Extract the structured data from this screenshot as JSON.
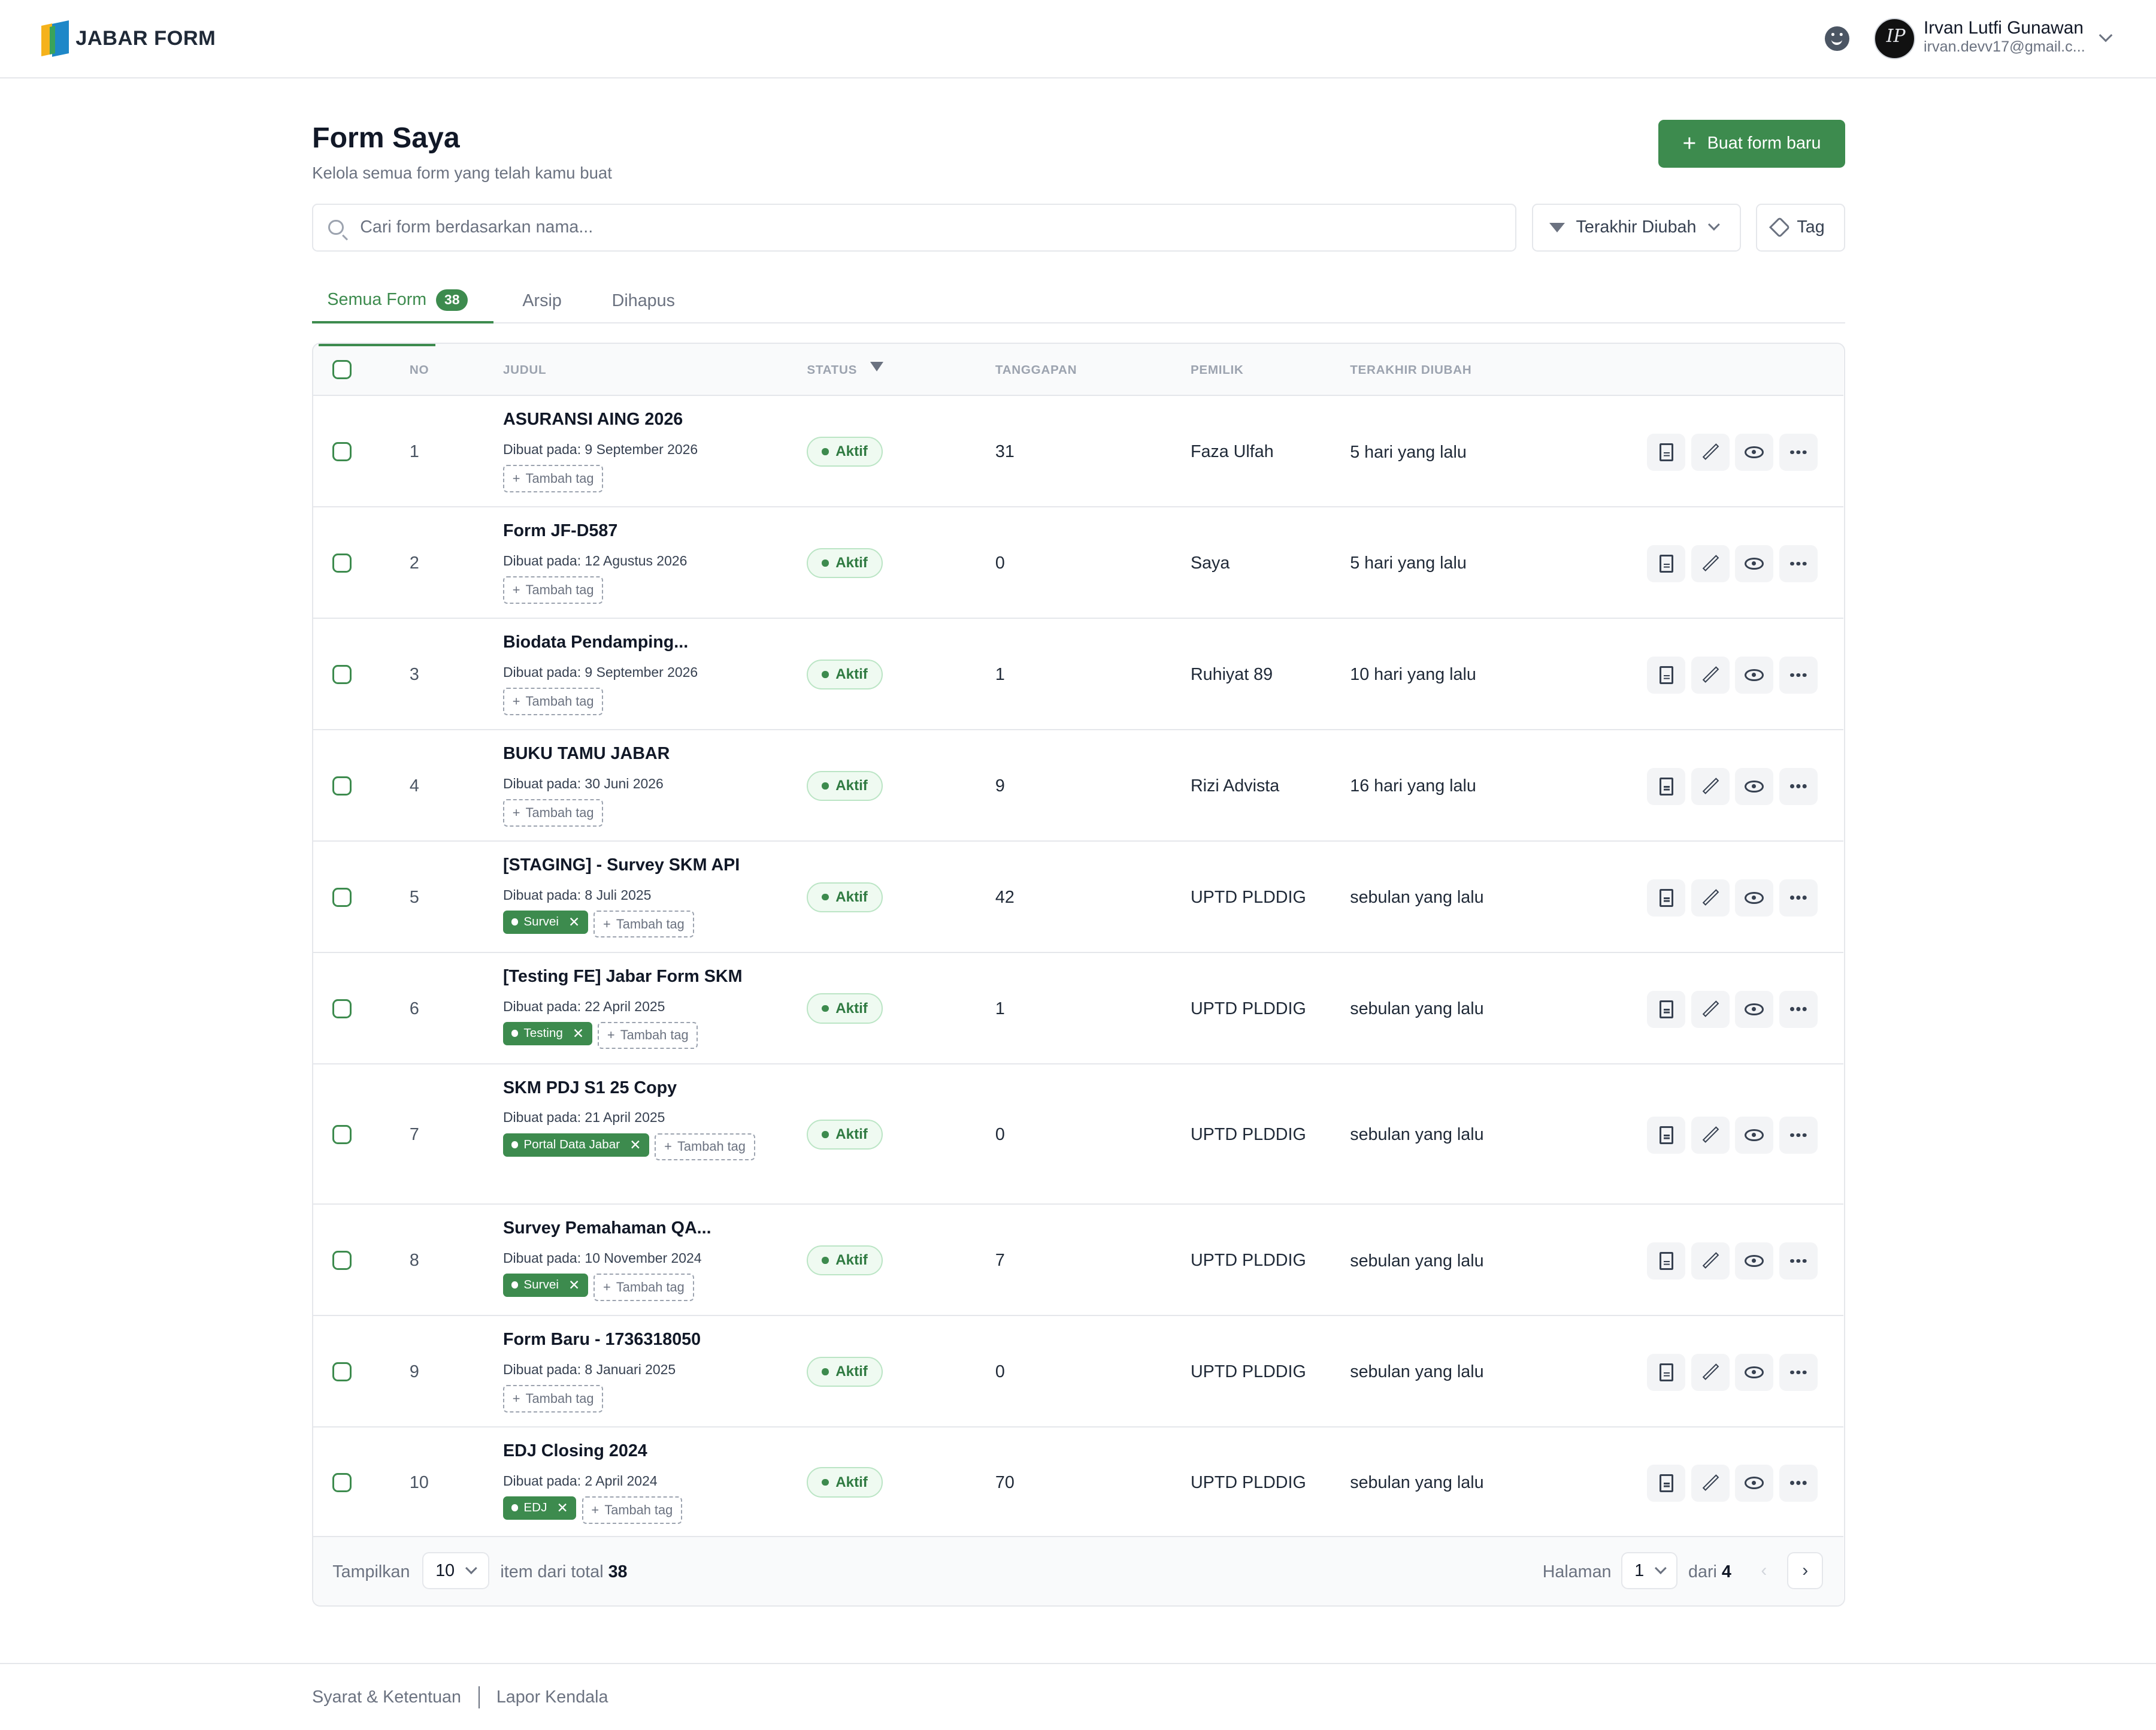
{
  "app": {
    "logo_text": "JABAR FORM"
  },
  "user": {
    "name": "Irvan Lutfi Gunawan",
    "email": "irvan.devv17@gmail.c...",
    "avatar_initials": "IP"
  },
  "page": {
    "title": "Form Saya",
    "subtitle": "Kelola semua form yang telah kamu buat",
    "new_button": "Buat form baru"
  },
  "search": {
    "placeholder": "Cari form berdasarkan nama...",
    "value": ""
  },
  "sort": {
    "label": "Terakhir Diubah"
  },
  "tag_filter": {
    "label": "Tag"
  },
  "tabs": [
    {
      "label": "Semua Form",
      "count": "38",
      "active": true
    },
    {
      "label": "Arsip"
    },
    {
      "label": "Dihapus"
    }
  ],
  "table": {
    "headers": {
      "no": "NO",
      "judul": "JUDUL",
      "status": "STATUS",
      "tanggapan": "TANGGAPAN",
      "pemilik": "PEMILIK",
      "terakhir": "TERAKHIR DIUBAH"
    },
    "add_tag_label": "Tambah tag",
    "rows": [
      {
        "no": "1",
        "title": "ASURANSI AING 2026",
        "created": "Dibuat pada: 9 September 2026",
        "tags": [],
        "status": "Aktif",
        "responses": "31",
        "owner": "Faza Ulfah",
        "updated": "5 hari yang lalu"
      },
      {
        "no": "2",
        "title": "Form JF-D587",
        "created": "Dibuat pada: 12 Agustus 2026",
        "tags": [],
        "status": "Aktif",
        "responses": "0",
        "owner": "Saya",
        "updated": "5 hari yang lalu"
      },
      {
        "no": "3",
        "title": "Biodata Pendamping...",
        "created": "Dibuat pada: 9 September 2026",
        "tags": [],
        "status": "Aktif",
        "responses": "1",
        "owner": "Ruhiyat 89",
        "updated": "10 hari yang lalu"
      },
      {
        "no": "4",
        "title": "BUKU TAMU JABAR",
        "created": "Dibuat pada: 30 Juni 2026",
        "tags": [],
        "status": "Aktif",
        "responses": "9",
        "owner": "Rizi Advista",
        "updated": "16 hari yang lalu"
      },
      {
        "no": "5",
        "title": "[STAGING] - Survey SKM API",
        "created": "Dibuat pada: 8 Juli 2025",
        "tags": [
          "Survei"
        ],
        "status": "Aktif",
        "responses": "42",
        "owner": "UPTD PLDDIG",
        "updated": "sebulan yang lalu"
      },
      {
        "no": "6",
        "title": "[Testing FE] Jabar Form SKM",
        "created": "Dibuat pada: 22 April 2025",
        "tags": [
          "Testing"
        ],
        "status": "Aktif",
        "responses": "1",
        "owner": "UPTD PLDDIG",
        "updated": "sebulan yang lalu"
      },
      {
        "no": "7",
        "title": "SKM PDJ S1 25 Copy",
        "created": "Dibuat pada: 21 April 2025",
        "tags": [
          "Portal Data Jabar"
        ],
        "status": "Aktif",
        "responses": "0",
        "owner": "UPTD PLDDIG",
        "updated": "sebulan yang lalu"
      },
      {
        "no": "8",
        "title": "Survey Pemahaman QA...",
        "created": "Dibuat pada: 10 November 2024",
        "tags": [
          "Survei"
        ],
        "status": "Aktif",
        "responses": "7",
        "owner": "UPTD PLDDIG",
        "updated": "sebulan yang lalu"
      },
      {
        "no": "9",
        "title": "Form Baru - 1736318050",
        "created": "Dibuat pada: 8 Januari 2025",
        "tags": [],
        "status": "Aktif",
        "responses": "0",
        "owner": "UPTD PLDDIG",
        "updated": "sebulan yang lalu"
      },
      {
        "no": "10",
        "title": "EDJ Closing 2024",
        "created": "Dibuat pada: 2 April 2024",
        "tags": [
          "EDJ"
        ],
        "status": "Aktif",
        "responses": "70",
        "owner": "UPTD PLDDIG",
        "updated": "sebulan yang lalu"
      }
    ]
  },
  "pagination": {
    "show_label": "Tampilkan",
    "per_page": "10",
    "total_prefix": "item dari total",
    "total": "38",
    "page_label": "Halaman",
    "page": "1",
    "of_label": "dari",
    "pages": "4"
  },
  "footer": {
    "terms": "Syarat & Ketentuan",
    "report": "Lapor Kendala"
  },
  "colors": {
    "primary": "#3d8b4e",
    "status_bg": "#effaf1"
  }
}
